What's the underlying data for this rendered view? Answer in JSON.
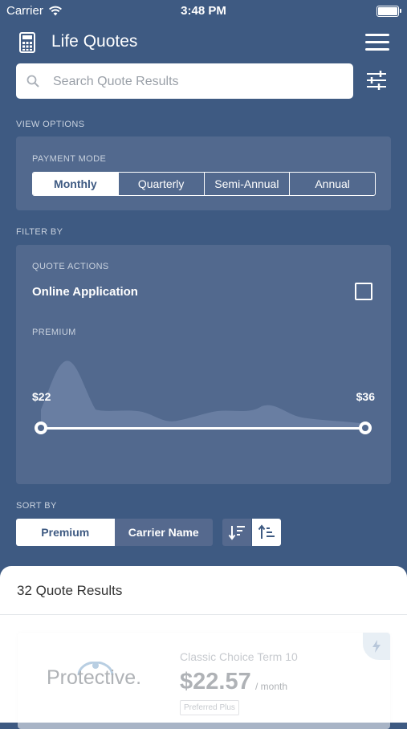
{
  "status_bar": {
    "carrier": "Carrier",
    "time": "3:48 PM"
  },
  "header": {
    "title": "Life Quotes"
  },
  "search": {
    "placeholder": "Search Quote Results"
  },
  "view_options": {
    "label": "VIEW OPTIONS",
    "payment_mode_label": "PAYMENT MODE",
    "modes": [
      "Monthly",
      "Quarterly",
      "Semi-Annual",
      "Annual"
    ],
    "selected_mode": "Monthly"
  },
  "filter_by": {
    "label": "FILTER BY",
    "quote_actions_label": "QUOTE ACTIONS",
    "online_application_label": "Online Application",
    "online_application_checked": false,
    "premium_label": "PREMIUM",
    "premium_min": "$22",
    "premium_max": "$36"
  },
  "sort_by": {
    "label": "SORT BY",
    "options": [
      "Premium",
      "Carrier Name"
    ],
    "selected": "Premium"
  },
  "results": {
    "count_text": "32 Quote Results",
    "items": [
      {
        "carrier": "Protective.",
        "plan": "Classic Choice Term 10",
        "price": "$22.57",
        "period": "/ month",
        "rating": "Preferred Plus"
      }
    ]
  },
  "colors": {
    "background": "#3e5a82",
    "card": "#52698e",
    "accent": "#ffffff"
  }
}
